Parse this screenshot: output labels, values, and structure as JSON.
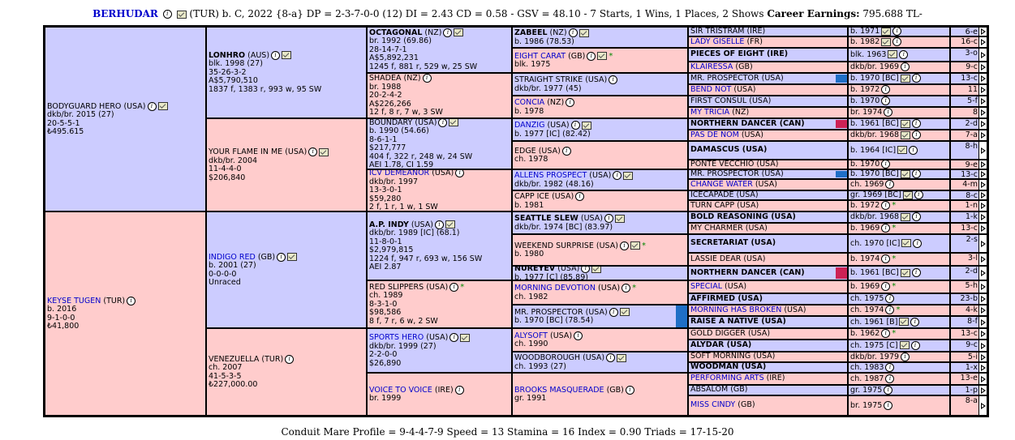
{
  "header": {
    "name": "BERHUDAR",
    "details": "(TUR) b. C, 2022 {8-a} DP = 2-3-7-0-0 (12) DI = 2.43 CD = 0.58 - GSV = 48.10 - 7 Starts, 1 Wins, 1 Places, 2 Shows",
    "earnings_label": "Career Earnings:",
    "earnings_value": "795.688 TL-"
  },
  "footer": "Conduit Mare Profile = 9-4-4-7-9   Speed = 13   Stamina = 16   Index = 0.90   Triads = 17-15-20",
  "gen1": [
    {
      "name": "BODYGUARD HERO",
      "country": "(USA)",
      "lines": [
        "dkb/br. 2015 (27)",
        "20-5-5-1",
        "₺495.615"
      ]
    },
    {
      "name": "KEYSE TUGEN",
      "country": "(TUR)",
      "lines": [
        "b. 2016",
        "9-1-0-0",
        "₺41,800"
      ]
    }
  ],
  "gen2": [
    {
      "name": "LONHRO",
      "country": "(AUS)",
      "lines": [
        "blk. 1998 (27)",
        "35-26-3-2",
        "A$5,790,510",
        "1837 f, 1383 r, 993 w, 95 SW"
      ]
    },
    {
      "name": "YOUR FLAME IN ME",
      "country": "(USA)",
      "lines": [
        "dkb/br. 2004",
        "11-4-4-0",
        "$206,840"
      ]
    },
    {
      "name": "INDIGO RED",
      "country": "(GB)",
      "lines": [
        "b. 2001 (27)",
        "0-0-0-0",
        "Unraced"
      ]
    },
    {
      "name": "VENEZUELLA",
      "country": "(TUR)",
      "lines": [
        "ch. 2007",
        "41-5-3-5",
        "₺227,000.00"
      ]
    }
  ],
  "gen3": [
    {
      "name": "OCTAGONAL",
      "country": "(NZ)",
      "lines": [
        "br. 1992 (69.86)",
        "28-14-7-1",
        "A$5,892,231",
        "1245 f, 881 r, 529 w, 25 SW"
      ]
    },
    {
      "name": "SHADEA",
      "country": "(NZ)",
      "lines": [
        "br. 1988",
        "20-2-4-2",
        "A$226,266",
        "12 f, 8 r, 7 w, 3 SW"
      ]
    },
    {
      "name": "BOUNDARY",
      "country": "(USA)",
      "lines": [
        "b. 1990 (54.66)",
        "8-6-1-1",
        "$217,777",
        "404 f, 322 r, 248 w, 24 SW",
        "AEI 1.78, CI 1.59"
      ]
    },
    {
      "name": "ICV DEMEANOR",
      "country": "(USA)",
      "lines": [
        "dkb/br. 1997",
        "13-3-0-1",
        "$59,280",
        "2 f, 1 r, 1 w, 1 SW"
      ]
    },
    {
      "name": "A.P. INDY",
      "country": "(USA)",
      "lines": [
        "dkb/br. 1989 [IC] (68.1)",
        "11-8-0-1",
        "$2,979,815",
        "1224 f, 947 r, 693 w, 156 SW",
        "AEI 2.87"
      ]
    },
    {
      "name": "RED SLIPPERS",
      "country": "(USA)",
      "lines": [
        "ch. 1989",
        "8-3-1-0",
        "$98,586",
        "8 f, 7 r, 6 w, 2 SW"
      ]
    },
    {
      "name": "SPORTS HERO",
      "country": "(USA)",
      "lines": [
        "dkb/br. 1999 (27)",
        "2-2-0-0",
        "$26,890"
      ]
    },
    {
      "name": "VOICE TO VOICE",
      "country": "(IRE)",
      "lines": [
        "br. 1999"
      ]
    }
  ],
  "gen4": [
    {
      "name": "ZABEEL",
      "country": "(NZ)",
      "lines": [
        "b. 1986 (78.53)"
      ]
    },
    {
      "name": "EIGHT CARAT",
      "country": "(GB)",
      "lines": [
        "blk. 1975"
      ]
    },
    {
      "name": "STRAIGHT STRIKE",
      "country": "(USA)",
      "lines": [
        "dkb/br. 1977 (45)"
      ]
    },
    {
      "name": "CONCIA",
      "country": "(NZ)",
      "lines": [
        "b. 1978"
      ]
    },
    {
      "name": "DANZIG",
      "country": "(USA)",
      "lines": [
        "b. 1977 [IC] (82.42)"
      ]
    },
    {
      "name": "EDGE",
      "country": "(USA)",
      "lines": [
        "ch. 1978"
      ]
    },
    {
      "name": "ALLENS PROSPECT",
      "country": "(USA)",
      "lines": [
        "dkb/br. 1982 (48.16)"
      ]
    },
    {
      "name": "CAPP ICE",
      "country": "(USA)",
      "lines": [
        "b. 1981"
      ]
    },
    {
      "name": "SEATTLE SLEW",
      "country": "(USA)",
      "lines": [
        "dkb/br. 1974 [BC] (83.97)"
      ]
    },
    {
      "name": "WEEKEND SURPRISE",
      "country": "(USA)",
      "lines": [
        "b. 1980"
      ]
    },
    {
      "name": "NUREYEV",
      "country": "(USA)",
      "lines": [
        "b. 1977 [C] (85.89)"
      ]
    },
    {
      "name": "MORNING DEVOTION",
      "country": "(USA)",
      "lines": [
        "ch. 1982"
      ]
    },
    {
      "name": "MR. PROSPECTOR",
      "country": "(USA)",
      "lines": [
        "b. 1970 [BC] (78.54)"
      ]
    },
    {
      "name": "ALYSOFT",
      "country": "(USA)",
      "lines": [
        "ch. 1990"
      ]
    },
    {
      "name": "WOODBOROUGH",
      "country": "(USA)",
      "lines": [
        "ch. 1993 (27)"
      ]
    },
    {
      "name": "BROOKS MASQUERADE",
      "country": "(GB)",
      "lines": [
        "gr. 1991"
      ]
    }
  ],
  "gen5": [
    {
      "name": "SIR TRISTRAM",
      "country": "(IRE)",
      "info": "b. 1971",
      "code": "6-e"
    },
    {
      "name": "LADY GISELLE",
      "country": "(FR)",
      "info": "b. 1982",
      "code": "16-c"
    },
    {
      "name": "PIECES OF EIGHT",
      "country": "(IRE)",
      "info": "blk. 1963",
      "code": "3-o"
    },
    {
      "name": "KLAIRESSA",
      "country": "(GB)",
      "info": "dkb/br. 1969",
      "code": "9-c"
    },
    {
      "name": "MR. PROSPECTOR",
      "country": "(USA)",
      "info": "b. 1970 [BC]",
      "code": "13-c"
    },
    {
      "name": "BEND NOT",
      "country": "(USA)",
      "info": "b. 1972",
      "code": "11"
    },
    {
      "name": "FIRST CONSUL",
      "country": "(USA)",
      "info": "b. 1970",
      "code": "5-f"
    },
    {
      "name": "MY TRICIA",
      "country": "(NZ)",
      "info": "br. 1974",
      "code": "8"
    },
    {
      "name": "NORTHERN DANCER",
      "country": "(CAN)",
      "info": "b. 1961 [BC]",
      "code": "2-d"
    },
    {
      "name": "PAS DE NOM",
      "country": "(USA)",
      "info": "dkb/br. 1968",
      "code": "7-a"
    },
    {
      "name": "DAMASCUS",
      "country": "(USA)",
      "info": "b. 1964 [IC]",
      "code": "8-h"
    },
    {
      "name": "PONTE VECCHIO",
      "country": "(USA)",
      "info": "b. 1970",
      "code": "9-e"
    },
    {
      "name": "MR. PROSPECTOR",
      "country": "(USA)",
      "info": "b. 1970 [BC]",
      "code": "13-c"
    },
    {
      "name": "CHANGE WATER",
      "country": "(USA)",
      "info": "ch. 1969",
      "code": "4-m"
    },
    {
      "name": "ICECAPADE",
      "country": "(USA)",
      "info": "gr. 1969 [BC]",
      "code": "8-c"
    },
    {
      "name": "TURN CAPP",
      "country": "(USA)",
      "info": "b. 1972",
      "code": "1-n"
    },
    {
      "name": "BOLD REASONING",
      "country": "(USA)",
      "info": "dkb/br. 1968",
      "code": "1-k"
    },
    {
      "name": "MY CHARMER",
      "country": "(USA)",
      "info": "b. 1969",
      "code": "13-c"
    },
    {
      "name": "SECRETARIAT",
      "country": "(USA)",
      "info": "ch. 1970 [IC]",
      "code": "2-s"
    },
    {
      "name": "LASSIE DEAR",
      "country": "(USA)",
      "info": "b. 1974",
      "code": "3-l"
    },
    {
      "name": "NORTHERN DANCER",
      "country": "(CAN)",
      "info": "b. 1961 [BC]",
      "code": "2-d"
    },
    {
      "name": "SPECIAL",
      "country": "(USA)",
      "info": "b. 1969",
      "code": "5-h"
    },
    {
      "name": "AFFIRMED",
      "country": "(USA)",
      "info": "ch. 1975",
      "code": "23-b"
    },
    {
      "name": "MORNING HAS BROKEN",
      "country": "(USA)",
      "info": "ch. 1974",
      "code": "4-k"
    },
    {
      "name": "RAISE A NATIVE",
      "country": "(USA)",
      "info": "ch. 1961 [B]",
      "code": "8-f"
    },
    {
      "name": "GOLD DIGGER",
      "country": "(USA)",
      "info": "b. 1962",
      "code": "13-c"
    },
    {
      "name": "ALYDAR",
      "country": "(USA)",
      "info": "ch. 1975 [C]",
      "code": "9-c"
    },
    {
      "name": "SOFT MORNING",
      "country": "(USA)",
      "info": "dkb/br. 1979",
      "code": "5-i"
    },
    {
      "name": "WOODMAN",
      "country": "(USA)",
      "info": "ch. 1983",
      "code": "1-x"
    },
    {
      "name": "PERFORMING ARTS",
      "country": "(IRE)",
      "info": "ch. 1987",
      "code": "13-e"
    },
    {
      "name": "ABSALOM",
      "country": "(GB)",
      "info": "gr. 1975",
      "code": "1-p"
    },
    {
      "name": "MISS CINDY",
      "country": "(GB)",
      "info": "br. 1975",
      "code": "8-a"
    }
  ]
}
